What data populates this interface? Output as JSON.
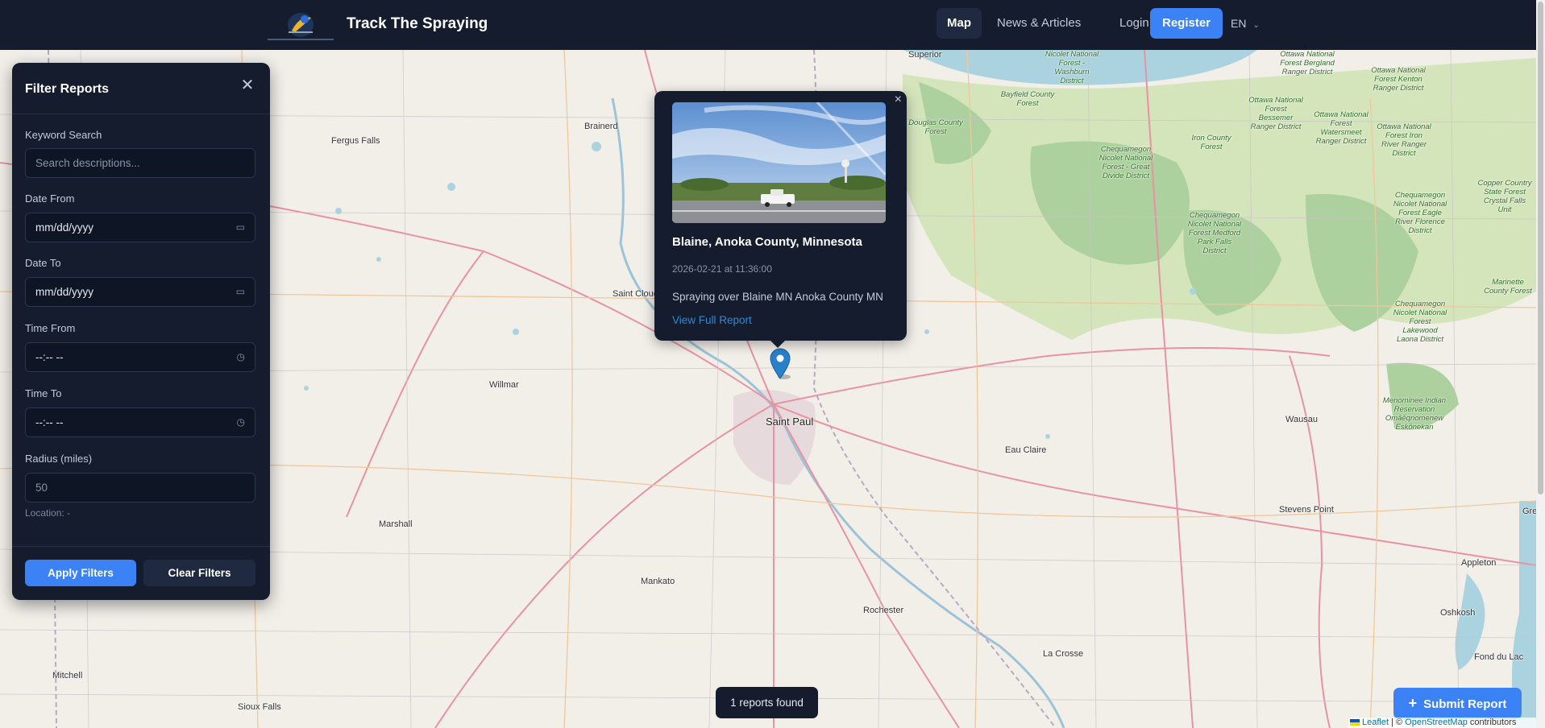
{
  "header": {
    "brand": "Track The Spraying",
    "nav": {
      "map": "Map",
      "news": "News & Articles",
      "login": "Login",
      "register": "Register",
      "language": "EN"
    }
  },
  "filter": {
    "title": "Filter Reports",
    "keyword_label": "Keyword Search",
    "keyword_placeholder": "Search descriptions...",
    "date_from_label": "Date From",
    "date_from_value": "mm/dd/yyyy",
    "date_to_label": "Date To",
    "date_to_value": "mm/dd/yyyy",
    "time_from_label": "Time From",
    "time_from_value": "--:-- --",
    "time_to_label": "Time To",
    "time_to_value": "--:-- --",
    "radius_label": "Radius (miles)",
    "radius_placeholder": "50",
    "location": "Location: -",
    "apply": "Apply Filters",
    "clear": "Clear Filters"
  },
  "popup": {
    "close": "×",
    "title": "Blaine, Anoka County, Minnesota",
    "timestamp": "2026-02-21 at 11:36:00",
    "description": "Spraying over Blaine MN Anoka County MN",
    "link": "View Full Report"
  },
  "status": {
    "reports_found": "1 reports found"
  },
  "submit": {
    "label": "Submit Report"
  },
  "attribution": {
    "leaflet": "Leaflet",
    "separator": " | © ",
    "osm": "OpenStreetMap",
    "suffix": " contributors"
  },
  "map_labels": {
    "saint_paul": "Saint Paul",
    "fergus_falls": "Fergus Falls",
    "brainerd": "Brainerd",
    "saint_cloud": "Saint Cloud",
    "willmar": "Willmar",
    "marshall": "Marshall",
    "mankato": "Mankato",
    "rochester": "Rochester",
    "la_crosse": "La Crosse",
    "eau_claire": "Eau Claire",
    "wausau": "Wausau",
    "stevens_point": "Stevens Point",
    "appleton": "Appleton",
    "oshkosh": "Oshkosh",
    "fond_du_lac": "Fond du Lac",
    "mitchell": "Mitchell",
    "sioux_falls": "Sioux Falls",
    "superior": "Superior",
    "douglas_forest": "Douglas County Forest",
    "bayfield_forest": "Bayfield County Forest",
    "washburn_forest": "Nicolet National Forest - Washburn District",
    "iron_forest": "Iron County Forest",
    "chequamegon_1": "Chequamegon Nicolet National Forest - Great Divide District",
    "chequamegon_2": "Chequamegon Nicolet National Forest Medford Park Falls District",
    "chequamegon_3": "Chequamegon Nicolet National Forest Eagle River Florence District",
    "chequamegon_4": "Chequamegon Nicolet National Forest Lakewood Laona District",
    "ottawa_1": "Ottawa National Forest Bessemer Ranger District",
    "ottawa_2": "Ottawa National Forest Watersmeet Ranger District",
    "ottawa_3": "Ottawa National Forest Iron River Ranger District",
    "ottawa_4": "Ottawa National Forest Kenton Ranger District",
    "ottawa_5": "Ottawa National Forest Bergland Ranger District",
    "copper_forest": "Copper Country State Forest Crystal Falls Unit",
    "marinette_forest": "Marinette County Forest",
    "menominee": "Menominee Indian Reservation Omāēqnomenew Eskōnekan",
    "green_bay": "Gree"
  }
}
